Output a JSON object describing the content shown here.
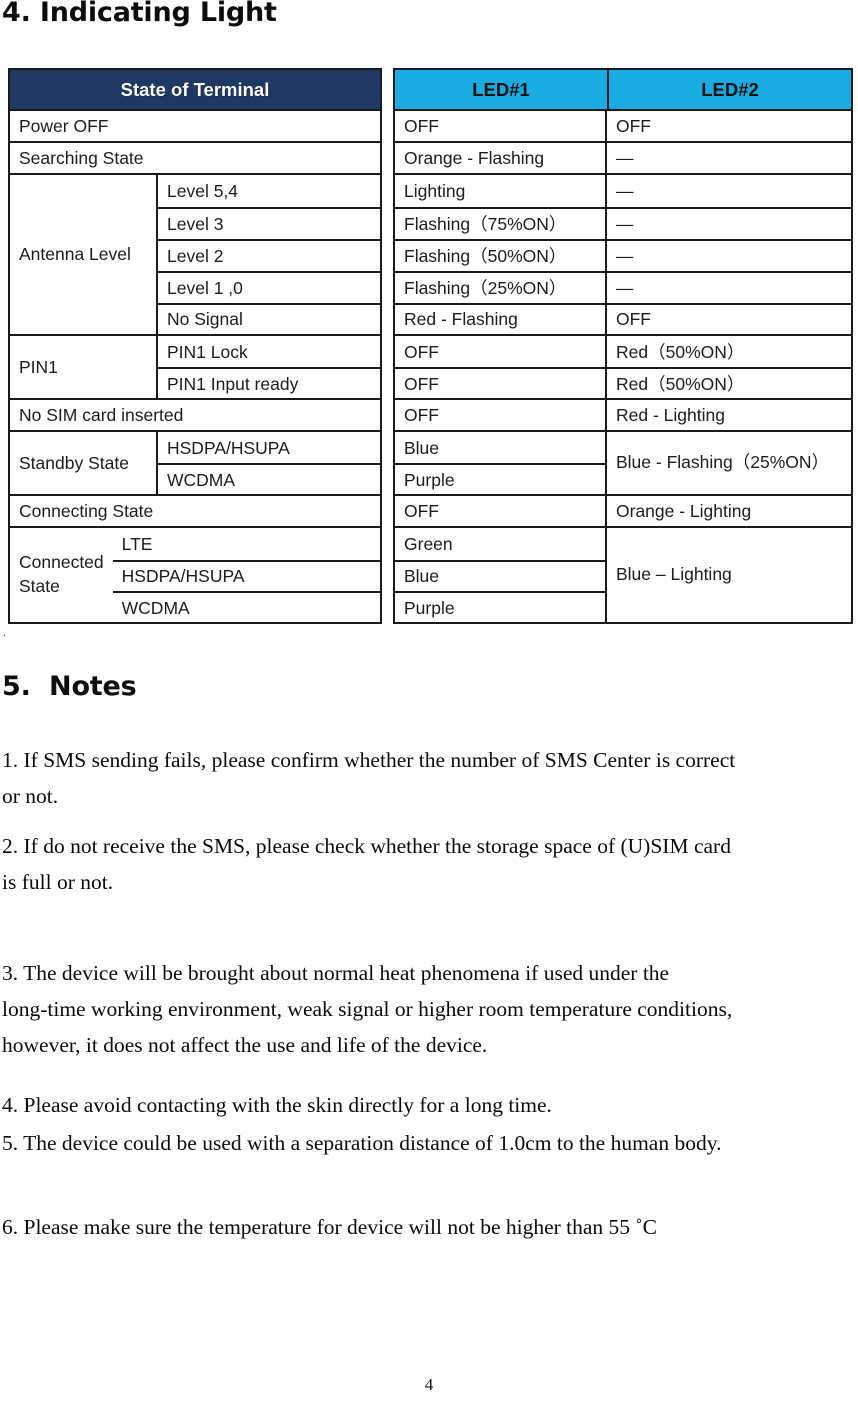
{
  "document": {
    "page_number": "4",
    "stray_mark": "."
  },
  "sections": {
    "indicating_light": {
      "heading": "4. Indicating Light"
    },
    "notes": {
      "heading": "5.  Notes"
    }
  },
  "table": {
    "headers": {
      "state_of_terminal": "State of Terminal",
      "led1": "LED#1",
      "led2": "LED#2"
    },
    "rows": [
      {
        "group": "Power OFF",
        "group_span": 1,
        "sub": null,
        "led1": "OFF",
        "led2": "OFF"
      },
      {
        "group": "Searching State",
        "group_span": 1,
        "sub": null,
        "led1": "Orange - Flashing",
        "led2": "—"
      },
      {
        "group": "Antenna Level",
        "group_span": 5,
        "subs": [
          "Level 5,4",
          "Level 3",
          "Level 2",
          "Level 1 ,0",
          "No Signal"
        ],
        "led1_list": [
          "Lighting",
          "Flashing（75%ON）",
          "Flashing（50%ON）",
          "Flashing（25%ON）",
          "Red - Flashing"
        ],
        "led2_list": [
          "—",
          "—",
          "—",
          "—",
          "OFF"
        ]
      },
      {
        "group": "PIN1",
        "group_span": 2,
        "subs": [
          "PIN1 Lock",
          "PIN1 Input ready"
        ],
        "led1_list": [
          "OFF",
          "OFF"
        ],
        "led2_list": [
          "Red（50%ON）",
          "Red（50%ON）"
        ]
      },
      {
        "group": "No SIM card inserted",
        "group_span": 1,
        "sub": null,
        "led1": "OFF",
        "led2": "Red - Lighting"
      },
      {
        "group": "Standby State",
        "group_span": 2,
        "subs": [
          "HSDPA/HSUPA",
          "WCDMA"
        ],
        "led1_list": [
          "Blue",
          "Purple"
        ],
        "led2_merged": "Blue - Flashing（25%ON）"
      },
      {
        "group": "Connecting State",
        "group_span": 1,
        "sub": null,
        "led1": "OFF",
        "led2": "Orange - Lighting"
      },
      {
        "group": "Connected\nState",
        "group_span": 3,
        "subs": [
          "LTE",
          "HSDPA/HSUPA",
          "WCDMA"
        ],
        "led1_list": [
          "Green",
          "Blue",
          "Purple"
        ],
        "led2_merged": "Blue – Lighting"
      }
    ]
  },
  "notes_list": [
    "1. If SMS sending fails, please confirm whether the number of SMS Center is correct\nor not.",
    "2. If do not receive the SMS, please check whether the storage space of (U)SIM card\nis full or not.",
    "3. The device will be brought about normal heat phenomena if used under the\nlong-time working environment, weak signal or higher room temperature conditions,\nhowever, it does not affect the use and life of the device.",
    "4. Please avoid contacting with the skin directly for a long time.",
    "5. The device could be used with a separation distance of 1.0cm to the human body.",
    "6. Please make sure the temperature for device will not be higher than 55 ˚C"
  ],
  "colors": {
    "header_dark": "#1F3864",
    "header_cyan": "#18ACE3",
    "border": "#1A1A1A"
  }
}
